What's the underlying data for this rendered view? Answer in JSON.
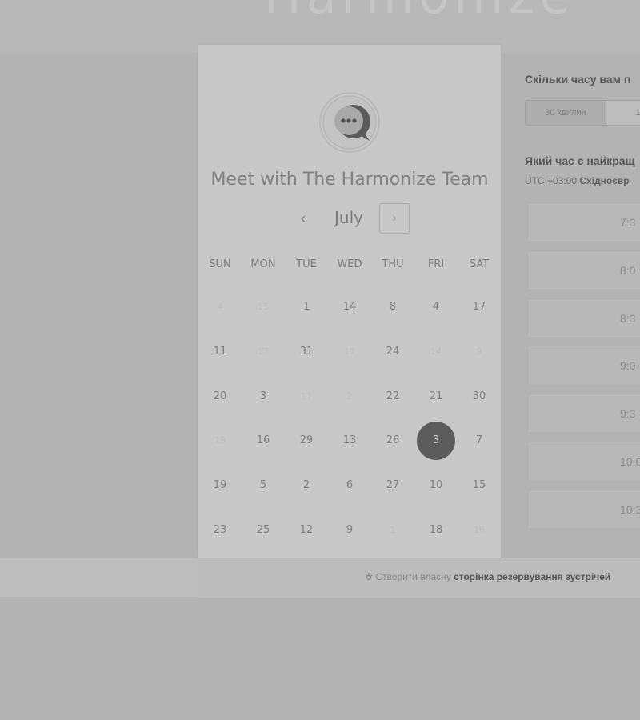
{
  "header": {
    "logo_text": "Harmonize"
  },
  "meeting": {
    "title": "Meet with The Harmonize Team",
    "avatar_icon": "chat-bubble-icon"
  },
  "calendar": {
    "month": "July",
    "prev_icon": "‹",
    "next_icon": "›",
    "weekdays": [
      "SUN",
      "MON",
      "TUE",
      "WED",
      "THU",
      "FRI",
      "SAT"
    ],
    "weeks": [
      [
        {
          "d": "4",
          "faded": true
        },
        {
          "d": "15",
          "faded": true
        },
        {
          "d": "1"
        },
        {
          "d": "14"
        },
        {
          "d": "8"
        },
        {
          "d": "4"
        },
        {
          "d": "17"
        }
      ],
      [
        {
          "d": "11"
        },
        {
          "d": "17",
          "faded": true
        },
        {
          "d": "31"
        },
        {
          "d": "17",
          "faded": true
        },
        {
          "d": "24"
        },
        {
          "d": "14",
          "faded": true
        },
        {
          "d": "9",
          "faded": true
        }
      ],
      [
        {
          "d": "20"
        },
        {
          "d": "3"
        },
        {
          "d": "17",
          "faded": true
        },
        {
          "d": "2",
          "faded": true
        },
        {
          "d": "22"
        },
        {
          "d": "21"
        },
        {
          "d": "30"
        }
      ],
      [
        {
          "d": "18",
          "faded": true
        },
        {
          "d": "16"
        },
        {
          "d": "29"
        },
        {
          "d": "13"
        },
        {
          "d": "26"
        },
        {
          "d": "3",
          "selected": true
        },
        {
          "d": "7"
        }
      ],
      [
        {
          "d": "19"
        },
        {
          "d": "5"
        },
        {
          "d": "2"
        },
        {
          "d": "6"
        },
        {
          "d": "27"
        },
        {
          "d": "10"
        },
        {
          "d": "15"
        }
      ],
      [
        {
          "d": "23"
        },
        {
          "d": "25"
        },
        {
          "d": "12"
        },
        {
          "d": "9"
        },
        {
          "d": "1",
          "faded": true
        },
        {
          "d": "18"
        },
        {
          "d": "16",
          "faded": true
        }
      ]
    ]
  },
  "booking": {
    "duration_question": "Скільки часу вам п",
    "duration_options": [
      "30 хвилин",
      "1"
    ],
    "time_question": "Який час є найкращ",
    "timezone_prefix": "UTC +03:00",
    "timezone_name": "Східноєвр",
    "slots": [
      "7:3",
      "8:0",
      "8:3",
      "9:0",
      "9:3",
      "10:0",
      "10:3"
    ]
  },
  "footer": {
    "prefix": "Створити власну",
    "link": "сторінка резервування зустрічей",
    "icon": "hubspot-sprocket-icon"
  },
  "colors": {
    "selected_day": "#5c5c5c",
    "background": "#b3b3b3",
    "panel": "#c8c8c8"
  }
}
